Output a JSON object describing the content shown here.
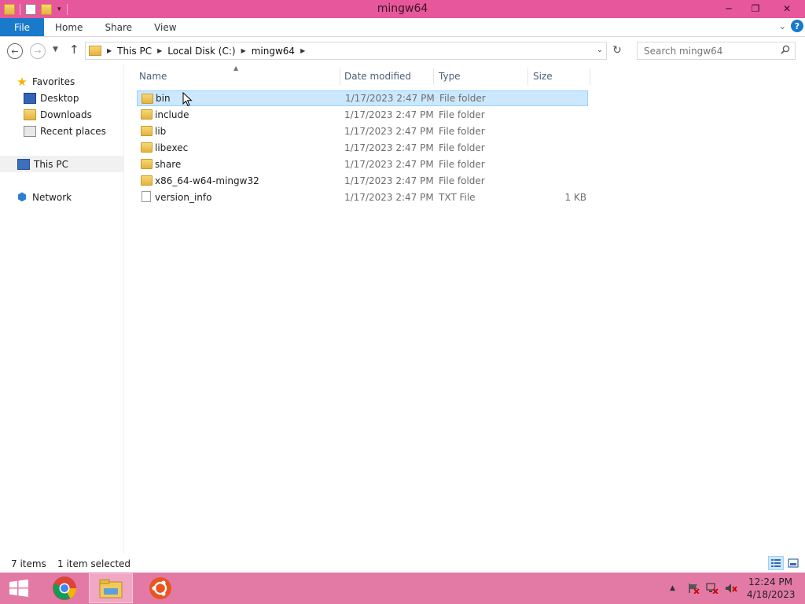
{
  "window": {
    "title": "mingw64"
  },
  "ribbon": {
    "tabs": [
      "File",
      "Home",
      "Share",
      "View"
    ]
  },
  "address": {
    "crumbs": [
      "This PC",
      "Local Disk (C:)",
      "mingw64"
    ]
  },
  "search": {
    "placeholder": "Search mingw64"
  },
  "nav": {
    "favorites": "Favorites",
    "desktop": "Desktop",
    "downloads": "Downloads",
    "recent": "Recent places",
    "this_pc": "This PC",
    "network": "Network"
  },
  "columns": {
    "name": "Name",
    "date": "Date modified",
    "type": "Type",
    "size": "Size"
  },
  "files": [
    {
      "name": "bin",
      "date": "1/17/2023 2:47 PM",
      "type": "File folder",
      "size": "",
      "icon": "folder-icon",
      "selected": true
    },
    {
      "name": "include",
      "date": "1/17/2023 2:47 PM",
      "type": "File folder",
      "size": "",
      "icon": "folder-icon"
    },
    {
      "name": "lib",
      "date": "1/17/2023 2:47 PM",
      "type": "File folder",
      "size": "",
      "icon": "folder-icon"
    },
    {
      "name": "libexec",
      "date": "1/17/2023 2:47 PM",
      "type": "File folder",
      "size": "",
      "icon": "folder-icon"
    },
    {
      "name": "share",
      "date": "1/17/2023 2:47 PM",
      "type": "File folder",
      "size": "",
      "icon": "folder-icon"
    },
    {
      "name": "x86_64-w64-mingw32",
      "date": "1/17/2023 2:47 PM",
      "type": "File folder",
      "size": "",
      "icon": "folder-icon"
    },
    {
      "name": "version_info",
      "date": "1/17/2023 2:47 PM",
      "type": "TXT File",
      "size": "1 KB",
      "icon": "text-file-icon"
    }
  ],
  "status": {
    "count": "7 items",
    "selection": "1 item selected"
  },
  "clock": {
    "time": "12:24 PM",
    "date": "4/18/2023"
  },
  "colors": {
    "titlebar": "#e7579b",
    "file_tab": "#1979ca",
    "selection": "#cce8ff",
    "taskbar": "#e37aa6"
  }
}
